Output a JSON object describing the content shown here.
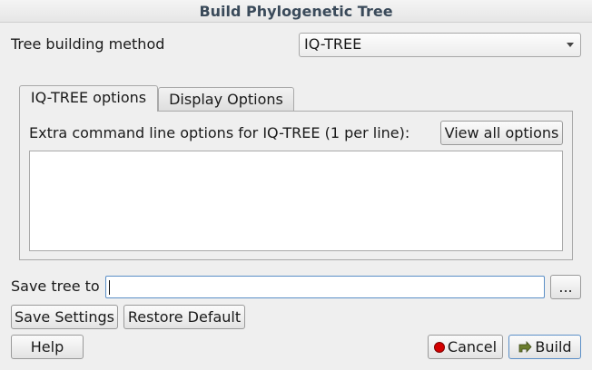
{
  "window": {
    "title": "Build Phylogenetic Tree"
  },
  "method": {
    "label": "Tree building method",
    "selected": "IQ-TREE"
  },
  "tabs": [
    {
      "label": "IQ-TREE options",
      "active": true
    },
    {
      "label": "Display Options",
      "active": false
    }
  ],
  "iqtree": {
    "extra_label": "Extra command line options for IQ-TREE (1 per line):",
    "view_all_label": "View all options",
    "extra_value": ""
  },
  "save": {
    "label": "Save tree to",
    "value": "",
    "browse_label": "..."
  },
  "settings": {
    "save_label": "Save Settings",
    "restore_label": "Restore Default"
  },
  "footer": {
    "help_label": "Help",
    "cancel_label": "Cancel",
    "build_label": "Build"
  },
  "colors": {
    "cancel_icon": "#d40000",
    "build_icon": "#6b7d2e",
    "focus_border": "#5b8fc7"
  }
}
